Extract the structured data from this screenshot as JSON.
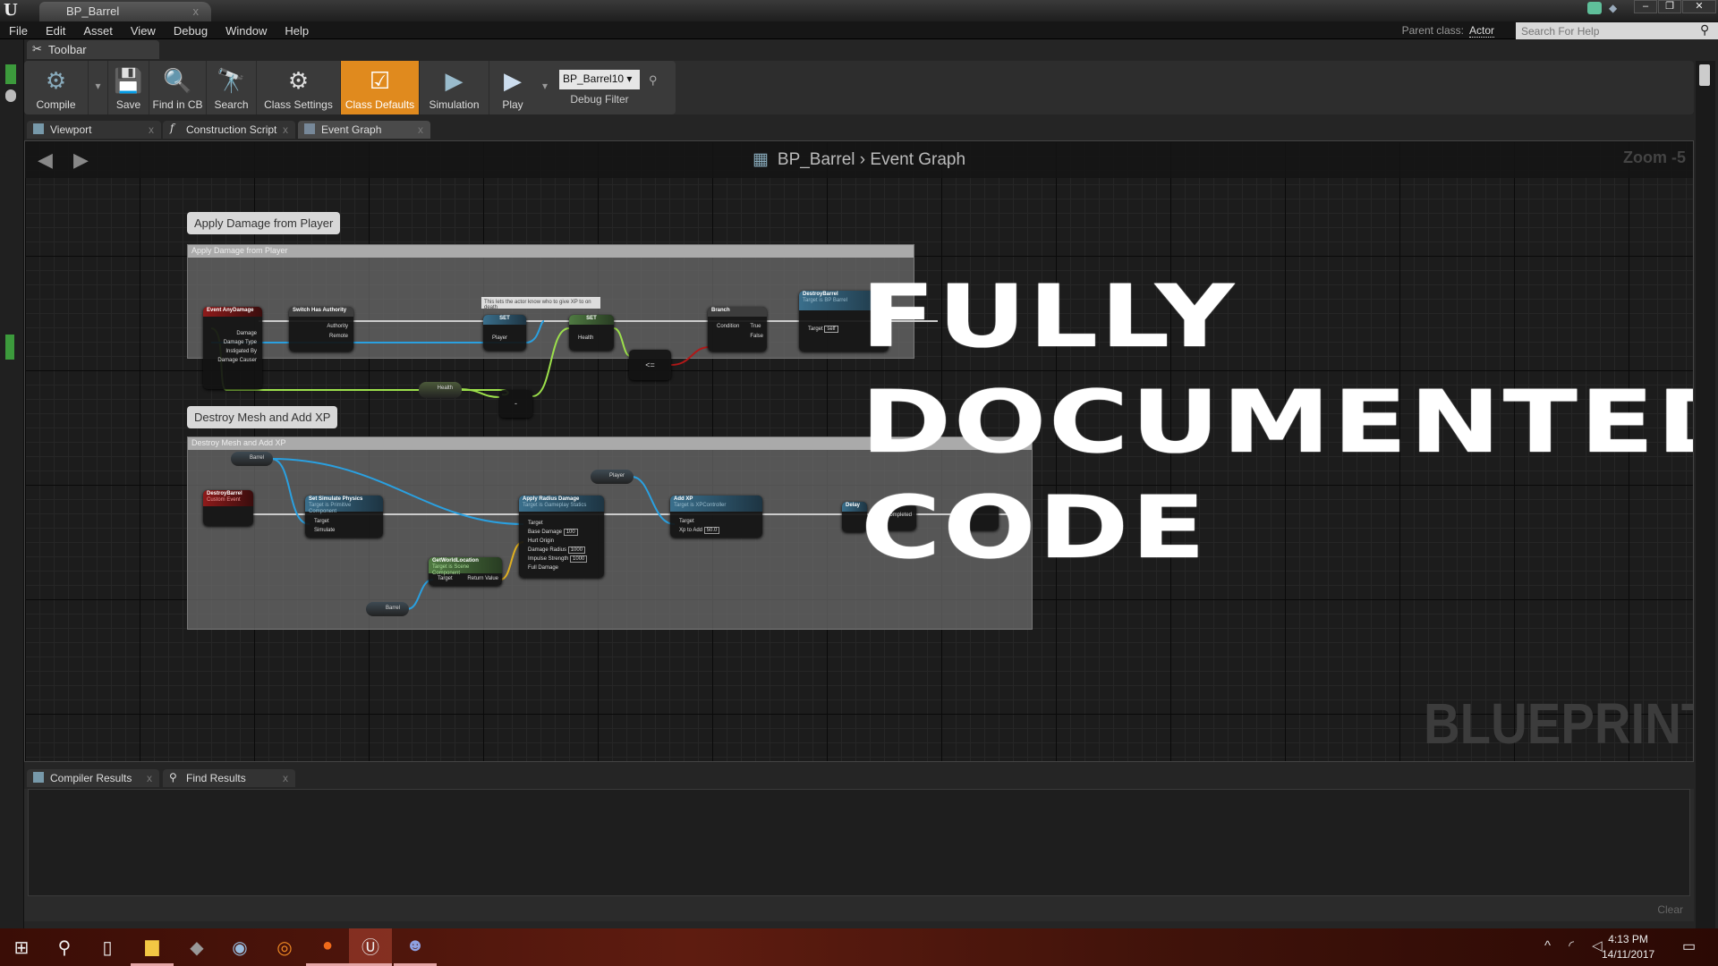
{
  "window": {
    "tab_title": "BP_Barrel",
    "close": "x",
    "minimize": "–",
    "restore": "❐",
    "close_window": "✕"
  },
  "menu": [
    "File",
    "Edit",
    "Asset",
    "View",
    "Debug",
    "Window",
    "Help"
  ],
  "header": {
    "parent_class_label": "Parent class:",
    "parent_class_value": "Actor",
    "search_placeholder": "Search For Help"
  },
  "toolbar": {
    "tab_label": "Toolbar",
    "buttons": [
      {
        "label": "Compile",
        "icon": "⚙"
      },
      {
        "label": "Save",
        "icon": "💾"
      },
      {
        "label": "Find in CB",
        "icon": "🔍"
      },
      {
        "label": "Search",
        "icon": "🔭"
      },
      {
        "label": "Class Settings",
        "icon": "⚙"
      },
      {
        "label": "Class Defaults",
        "icon": "☑"
      },
      {
        "label": "Simulation",
        "icon": "▶"
      },
      {
        "label": "Play",
        "icon": "▶"
      }
    ],
    "debug_object": "BP_Barrel10 ▾",
    "debug_filter_label": "Debug Filter"
  },
  "doc_tabs": [
    {
      "label": "Viewport"
    },
    {
      "label": "Construction Script"
    },
    {
      "label": "Event Graph"
    }
  ],
  "graph": {
    "breadcrumb_root": "BP_Barrel",
    "breadcrumb_sep": "›",
    "breadcrumb_current": "Event Graph",
    "zoom": "Zoom -5",
    "watermark": "BLUEPRINT",
    "overlay_lines": [
      "FULLY",
      "DOCUMENTED",
      "CODE"
    ],
    "comments": [
      {
        "bubble": "Apply Damage from Player",
        "header": "Apply Damage from Player",
        "nodes": {
          "event": "Event AnyDamage",
          "switch": "Switch Has Authority",
          "set_player": "SET",
          "set_health": "SET",
          "branch": "Branch",
          "destroy": "DestroyBarrel",
          "note": "This lets the actor know who to give XP to on death",
          "health_get": "Health",
          "minus": "-",
          "lte": "<=",
          "pins": {
            "damage": "Damage",
            "damage_type": "Damage Type",
            "instigated_by": "Instigated By",
            "damage_causer": "Damage Causer",
            "authority": "Authority",
            "remote": "Remote",
            "player": "Player",
            "health": "Health",
            "condition": "Condition",
            "true": "True",
            "false": "False",
            "target": "Target",
            "self": "self"
          },
          "destroy_sub": "Target is BP Barrel"
        }
      },
      {
        "bubble": "Destroy Mesh and Add XP",
        "header": "Destroy Mesh and Add XP",
        "nodes": {
          "barrel1": "Barrel",
          "barrel2": "Barrel",
          "player": "Player",
          "event": "DestroyBarrel",
          "event_sub": "Custom Event",
          "simulate": "Set Simulate Physics",
          "simulate_sub": "Target is Primitive Component",
          "radius": "Apply Radius Damage",
          "radius_sub": "Target is Gameplay Statics",
          "location": "GetWorldLocation",
          "location_sub": "Target is Scene Component",
          "addxp": "Add XP",
          "addxp_sub": "Target is XPController",
          "delay": "Delay",
          "completed": "Completed",
          "pins": {
            "target": "Target",
            "simulate": "Simulate",
            "base_damage": "Base Damage",
            "base_damage_val": "100",
            "hurt_origin": "Hurt Origin",
            "damage_radius": "Damage Radius",
            "damage_radius_val": "1000",
            "impulse": "Impulse Strength",
            "impulse_val": "1000",
            "full_damage": "Full Damage",
            "return_value": "Return Value",
            "xp_to_add": "Xp to Add",
            "xp_val": "50.0"
          }
        }
      }
    ]
  },
  "bottom_tabs": [
    {
      "label": "Compiler Results"
    },
    {
      "label": "Find Results"
    }
  ],
  "output": {
    "clear_label": "Clear"
  },
  "taskbar": {
    "time": "4:13 PM",
    "date": "14/11/2017",
    "apps": [
      "start",
      "search",
      "task-view",
      "file-explorer",
      "app",
      "app",
      "blender",
      "firefox",
      "unreal-engine",
      "discord"
    ]
  }
}
